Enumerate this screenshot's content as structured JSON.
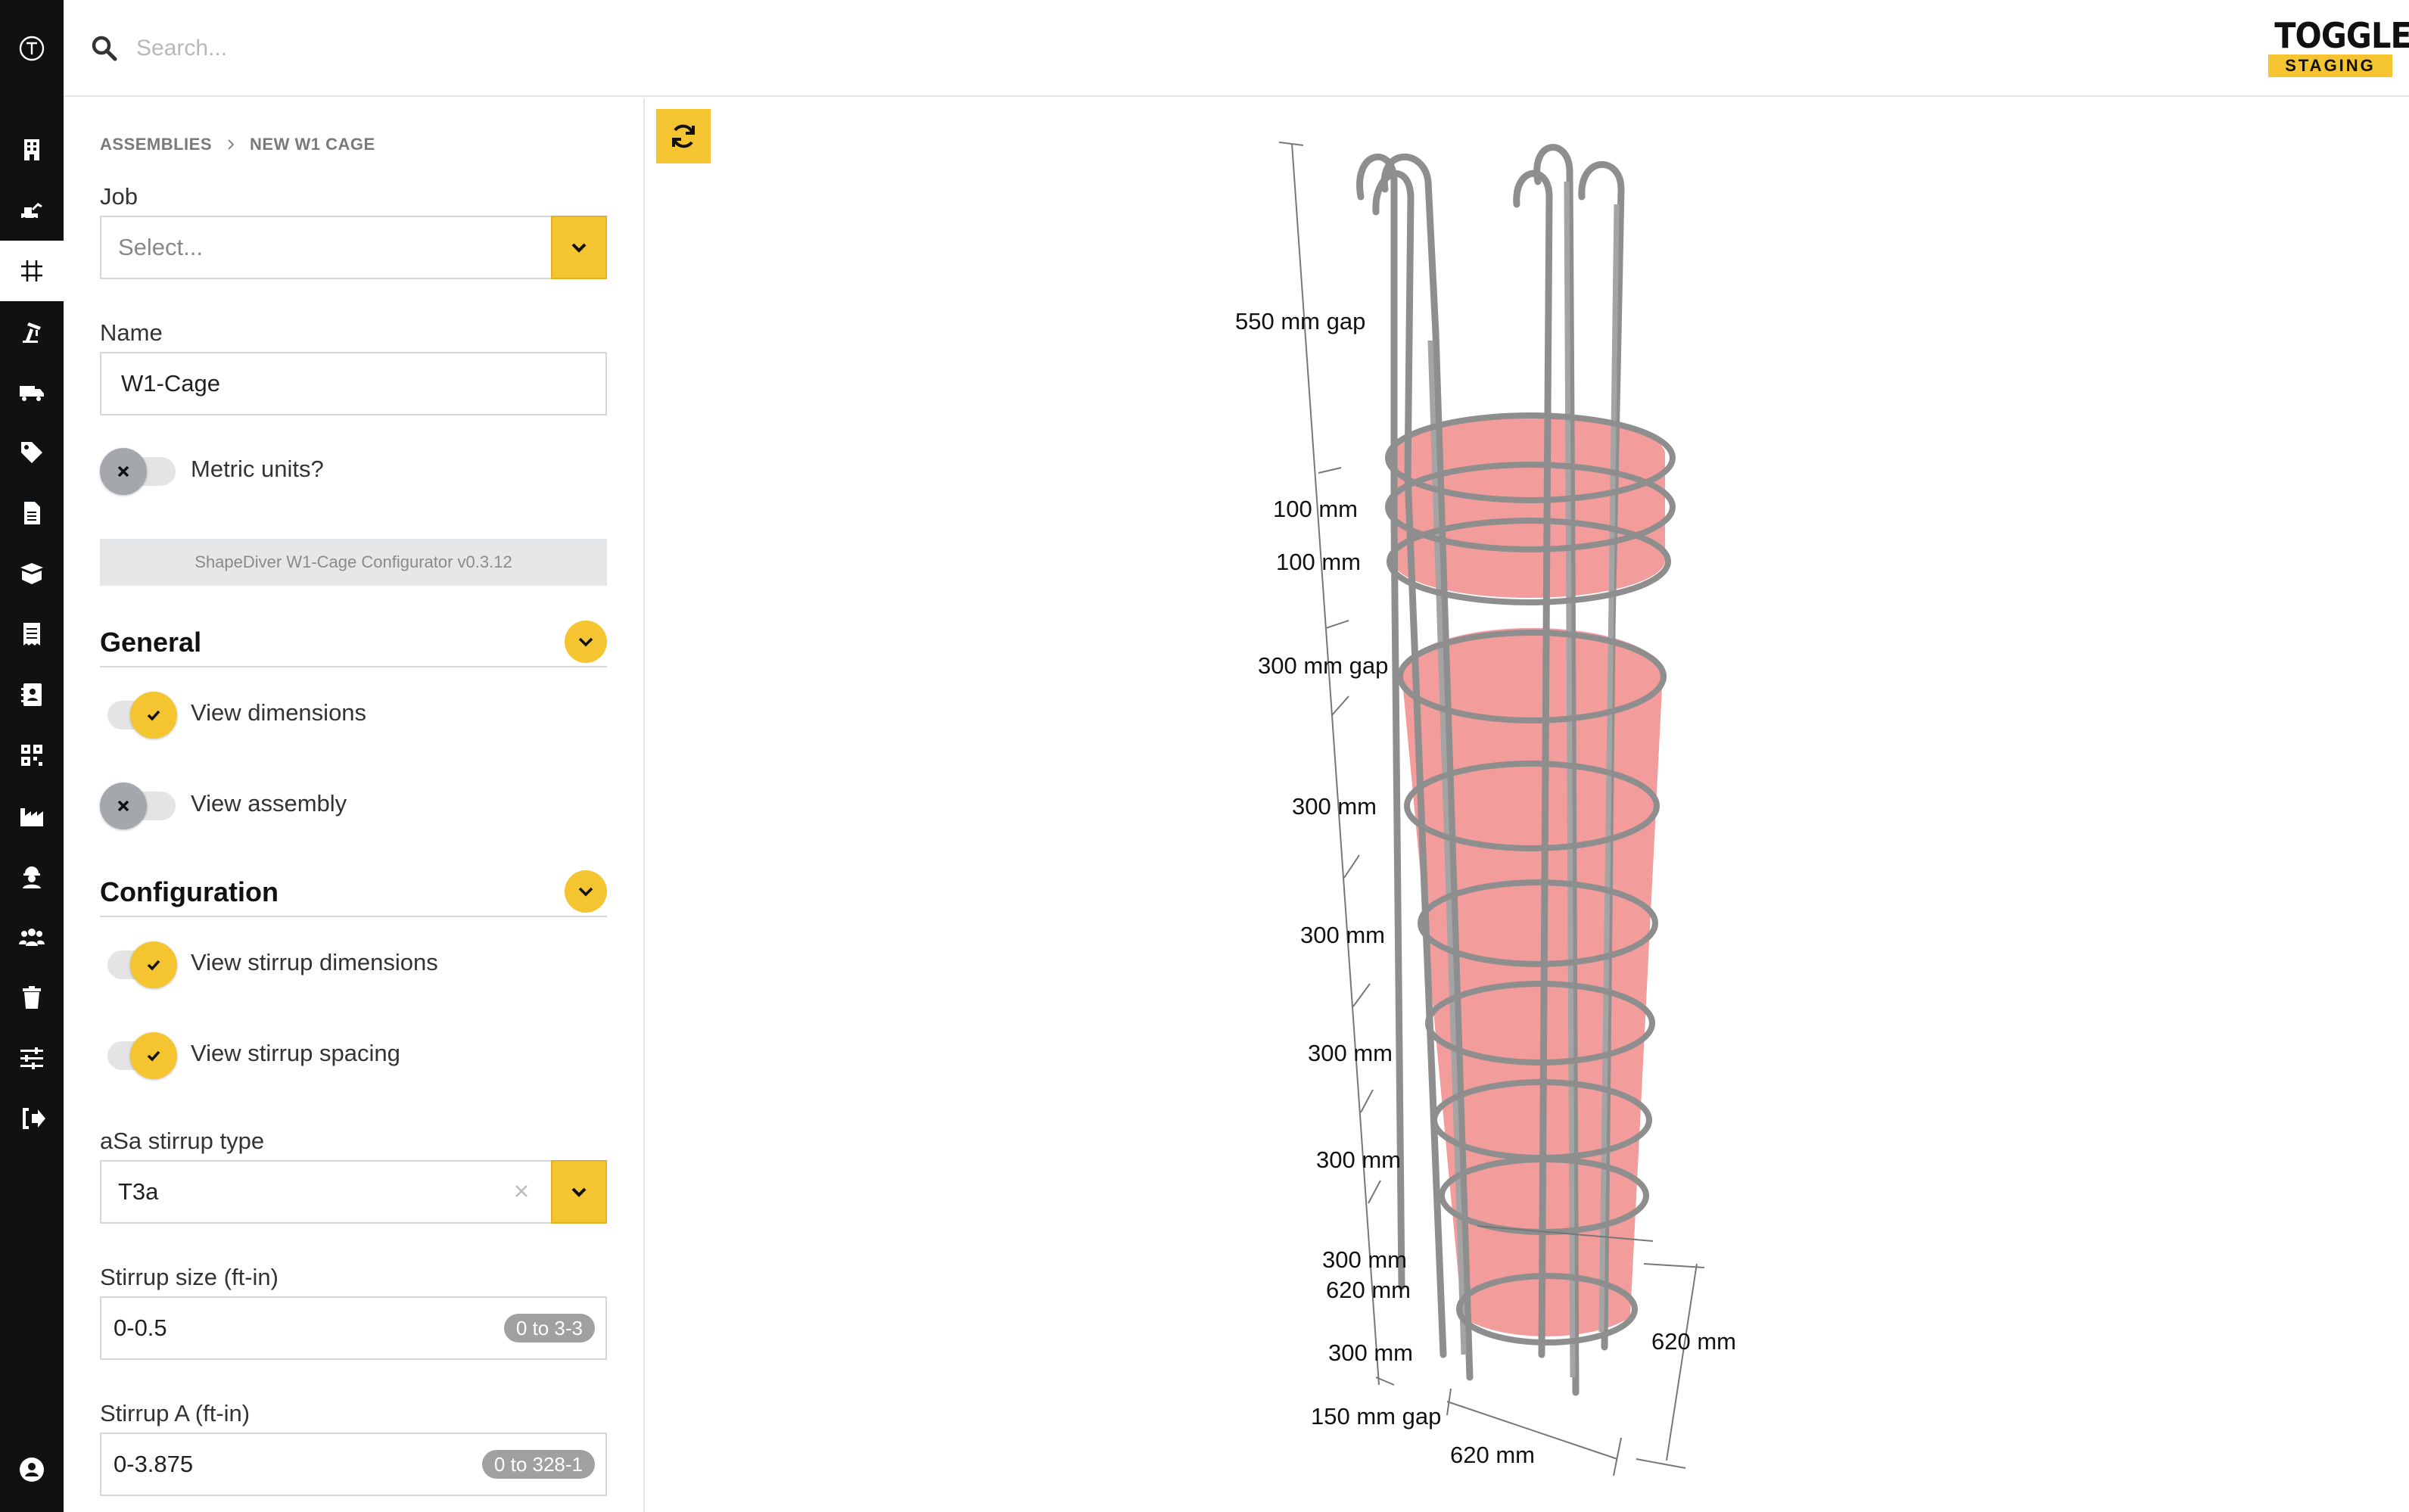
{
  "search": {
    "placeholder": "Search..."
  },
  "brand": {
    "name": "TOGGLE",
    "environment": "STAGING"
  },
  "breadcrumb": [
    "ASSEMBLIES",
    "NEW W1 CAGE"
  ],
  "form": {
    "job_label": "Job",
    "job_placeholder": "Select...",
    "name_label": "Name",
    "name_value": "W1-Cage",
    "metric_label": "Metric units?",
    "metric_on": false,
    "version_label": "ShapeDiver W1-Cage Configurator v0.3.12"
  },
  "general": {
    "title": "General",
    "view_dimensions_label": "View dimensions",
    "view_dimensions_on": true,
    "view_assembly_label": "View assembly",
    "view_assembly_on": false
  },
  "configuration": {
    "title": "Configuration",
    "view_stirrup_dimensions_label": "View stirrup dimensions",
    "view_stirrup_dimensions_on": true,
    "view_stirrup_spacing_label": "View stirrup spacing",
    "view_stirrup_spacing_on": true,
    "stirrup_type_label": "aSa stirrup type",
    "stirrup_type_value": "T3a",
    "stirrup_size_label": "Stirrup size (ft-in)",
    "stirrup_size_value": "0-0.5",
    "stirrup_size_range": "0 to 3-3",
    "stirrup_a_label": "Stirrup A (ft-in)",
    "stirrup_a_value": "0-3.875",
    "stirrup_a_range": "0 to 328-1"
  },
  "viewer": {
    "dimensions": {
      "top_gap": "550 mm gap",
      "d1": "100 mm",
      "d2": "100 mm",
      "mid_gap": "300 mm gap",
      "s1": "300 mm",
      "s2": "300 mm",
      "s3": "300 mm",
      "s4": "300 mm",
      "s5": "300 mm",
      "s6": "300 mm",
      "bottom_gap": "150 mm gap",
      "diam_inner": "620 mm",
      "diam_right": "620 mm",
      "diam_bottom": "620 mm"
    }
  },
  "colors": {
    "accent": "#f4c531",
    "rail": "#0f1113",
    "cage_fill": "#f08080",
    "rebar": "#8e8e8e"
  },
  "icons": {
    "rail": [
      "toggle-logo-icon",
      "building-icon",
      "excavator-icon",
      "grid-icon",
      "crane-icon",
      "truck-icon",
      "tag-icon",
      "document-icon",
      "box-icon",
      "receipt-icon",
      "contact-card-icon",
      "qr-code-icon",
      "factory-icon",
      "worker-icon",
      "users-icon",
      "trash-icon",
      "sliders-icon",
      "sign-out-icon",
      "account-icon"
    ]
  }
}
